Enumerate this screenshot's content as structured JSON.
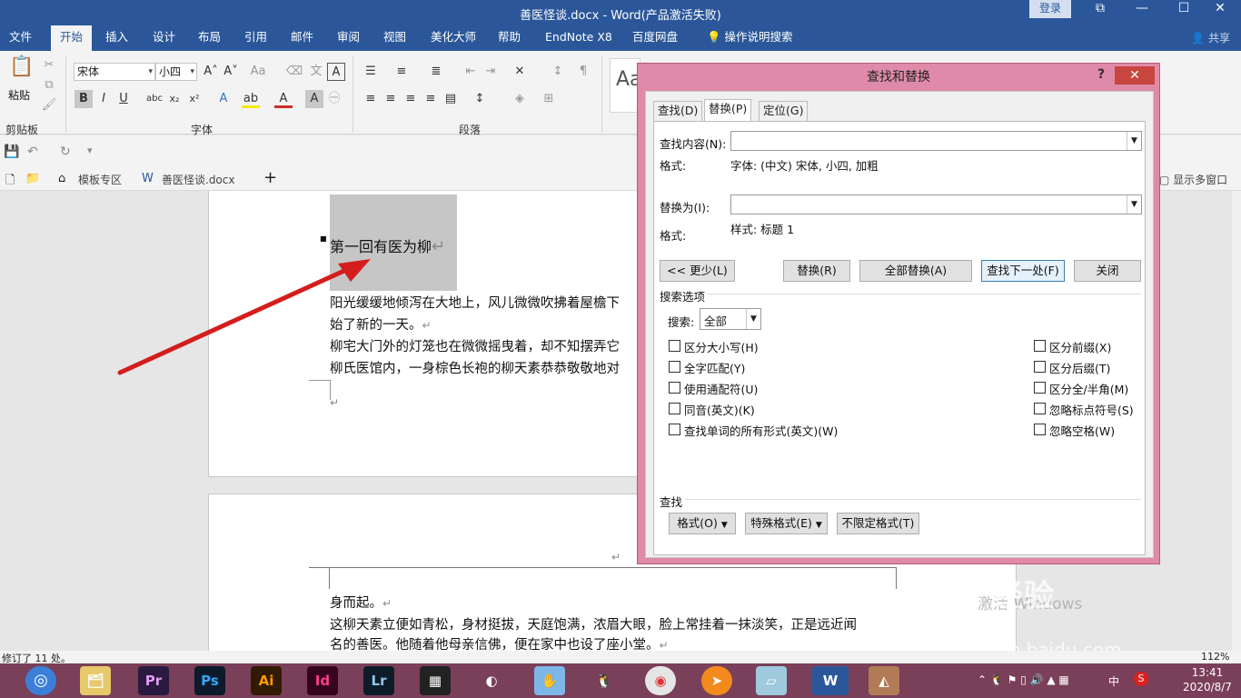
{
  "window": {
    "title": "善医怪谈.docx  -  Word(产品激活失败)",
    "login": "登录",
    "controls": [
      "⧉",
      "—",
      "☐",
      "✕"
    ]
  },
  "ribbon_tabs": [
    "文件",
    "开始",
    "插入",
    "设计",
    "布局",
    "引用",
    "邮件",
    "审阅",
    "视图",
    "美化大师",
    "帮助",
    "EndNote X8",
    "百度网盘",
    "操作说明搜索"
  ],
  "share": "共享",
  "ribbon": {
    "clipboard": {
      "paste": "粘贴",
      "label": "剪贴板"
    },
    "font": {
      "name": "宋体",
      "size": "小四",
      "label": "字体"
    },
    "paragraph": {
      "label": "段落"
    },
    "styles_preview": "Aa"
  },
  "doc_tabs": [
    "模板专区",
    "善医怪谈.docx"
  ],
  "multi_window": "显示多窗口",
  "document": {
    "heading": "第一回有医为柳",
    "lines": [
      "阳光缓缓地倾泻在大地上，风儿微微吹拂着屋檐下",
      "始了新的一天。",
      "柳宅大门外的灯笼也在微微摇曳着，却不知摆弄它",
      "柳氏医馆内，一身棕色长袍的柳天素恭恭敬敬地对"
    ],
    "page2_lines": [
      "身而起。",
      "这柳天素立便如青松，身材挺拔，天庭饱满，浓眉大眼，脸上常挂着一抹淡笑，正是远近闻",
      "名的善医。他随着他母亲信佛，便在家中也设了座小堂。"
    ]
  },
  "status": {
    "left": "修订了 11 处。",
    "zoom": "112%"
  },
  "watermark": {
    "brand": "Bai 经验",
    "url": "jingyan.baidu.com",
    "activate": "激活 Windows"
  },
  "taskbar": {
    "apps": [
      "Pr",
      "Ps",
      "Ai",
      "Id",
      "Lr"
    ],
    "time": "13:41",
    "date": "2020/8/7",
    "ime": "中"
  },
  "dialog": {
    "title": "查找和替换",
    "help": "?",
    "close": "✕",
    "tabs": [
      "查找(D)",
      "替换(P)",
      "定位(G)"
    ],
    "find_label": "查找内容(N):",
    "find_value": "",
    "find_format_label": "格式:",
    "find_format_value": "字体: (中文) 宋体, 小四, 加粗",
    "replace_label": "替换为(I):",
    "replace_value": "",
    "replace_format_label": "格式:",
    "replace_format_value": "样式: 标题 1",
    "buttons": {
      "less": "<< 更少(L)",
      "replace": "替换(R)",
      "replace_all": "全部替换(A)",
      "find_next": "查找下一处(F)",
      "close": "关闭"
    },
    "search_options_label": "搜索选项",
    "search_label": "搜索:",
    "search_value": "全部",
    "left_options": [
      "区分大小写(H)",
      "全字匹配(Y)",
      "使用通配符(U)",
      "同音(英文)(K)",
      "查找单词的所有形式(英文)(W)"
    ],
    "right_options": [
      "区分前缀(X)",
      "区分后缀(T)",
      "区分全/半角(M)",
      "忽略标点符号(S)",
      "忽略空格(W)"
    ],
    "find_section_label": "查找",
    "bottom_buttons": {
      "format": "格式(O)",
      "special": "特殊格式(E)",
      "no_format": "不限定格式(T)"
    }
  }
}
